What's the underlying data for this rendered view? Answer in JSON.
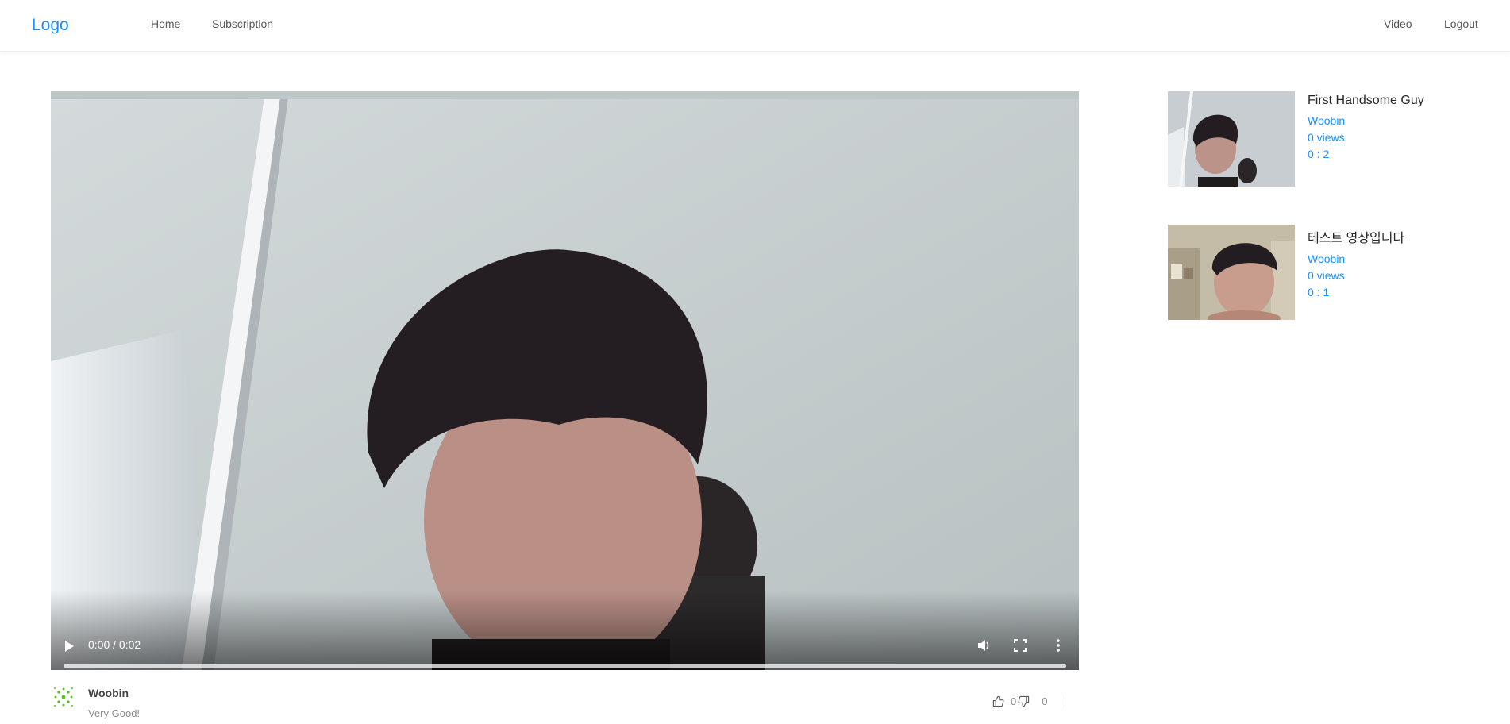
{
  "header": {
    "logo": "Logo",
    "nav_left": [
      "Home",
      "Subscription"
    ],
    "nav_right": [
      "Video",
      "Logout"
    ]
  },
  "video": {
    "time_display": "0:00 / 0:02",
    "progress": 0,
    "controls": [
      "play-icon",
      "volume-icon",
      "fullscreen-icon",
      "more-icon"
    ]
  },
  "detail": {
    "author": "Woobin",
    "description": "Very Good!",
    "likes": "0",
    "dislikes": "0"
  },
  "sidebar": {
    "items": [
      {
        "title": "First Handsome Guy",
        "author": "Woobin",
        "views": "0 views",
        "duration": "0 : 2"
      },
      {
        "title": "테스트 영상입니다",
        "author": "Woobin",
        "views": "0 views",
        "duration": "0 : 1"
      }
    ]
  },
  "colors": {
    "accent": "#1890ff",
    "avatar": "#52c41a"
  }
}
